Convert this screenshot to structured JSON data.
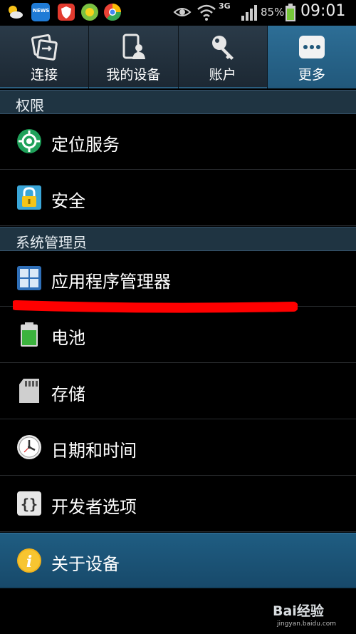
{
  "status_bar": {
    "network": "3G",
    "battery": "85%",
    "time": "09:01",
    "left_icons": [
      "weather-icon",
      "news-icon",
      "shield-app-icon",
      "game-app-icon",
      "browser-icon"
    ],
    "news_label": "NEWS"
  },
  "tabs": [
    {
      "label": "连接",
      "icon": "connections-icon",
      "active": false
    },
    {
      "label": "我的设备",
      "icon": "my-device-icon",
      "active": false
    },
    {
      "label": "账户",
      "icon": "key-icon",
      "active": false
    },
    {
      "label": "更多",
      "icon": "more-icon",
      "active": true
    }
  ],
  "sections": [
    {
      "title": "权限"
    },
    {
      "title": "系统管理员"
    }
  ],
  "items": [
    {
      "label": "定位服务",
      "icon": "location-icon"
    },
    {
      "label": "安全",
      "icon": "lock-icon"
    },
    {
      "label": "应用程序管理器",
      "icon": "apps-grid-icon"
    },
    {
      "label": "电池",
      "icon": "battery-icon"
    },
    {
      "label": "存储",
      "icon": "sd-card-icon"
    },
    {
      "label": "日期和时间",
      "icon": "clock-icon"
    },
    {
      "label": "开发者选项",
      "icon": "braces-icon"
    },
    {
      "label": "关于设备",
      "icon": "info-icon"
    }
  ],
  "colors": {
    "accent": "#21587b",
    "annotation": "#ff0000"
  },
  "watermark": {
    "brand": "Bai经验",
    "url": "jingyan.baidu.com"
  }
}
